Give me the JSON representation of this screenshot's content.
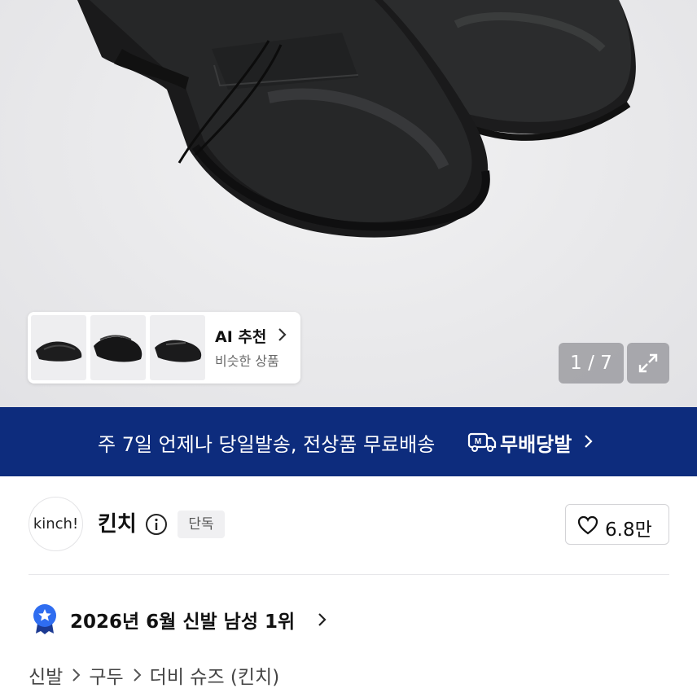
{
  "ai_recommend": {
    "title": "AI 추천",
    "subtitle": "비슷한 상품"
  },
  "gallery": {
    "counter": "1 / 7"
  },
  "banner": {
    "text": "주 7일 언제나 당일발송, 전상품 무료배송",
    "brand": "무배당발",
    "bg_color": "#0d2c7d"
  },
  "brand": {
    "logo_text": "kinch!",
    "name": "킨치",
    "badge": "단독",
    "likes": "6.8만"
  },
  "ranking": {
    "text": "2026년 6월 신발 남성 1위"
  },
  "breadcrumb": {
    "items": [
      "신발",
      "구두",
      "더비 슈즈 (킨치)"
    ]
  },
  "icons": [
    "chevron-right-icon",
    "expand-icon",
    "truck-icon",
    "info-icon",
    "heart-icon",
    "rank-medal-icon"
  ]
}
